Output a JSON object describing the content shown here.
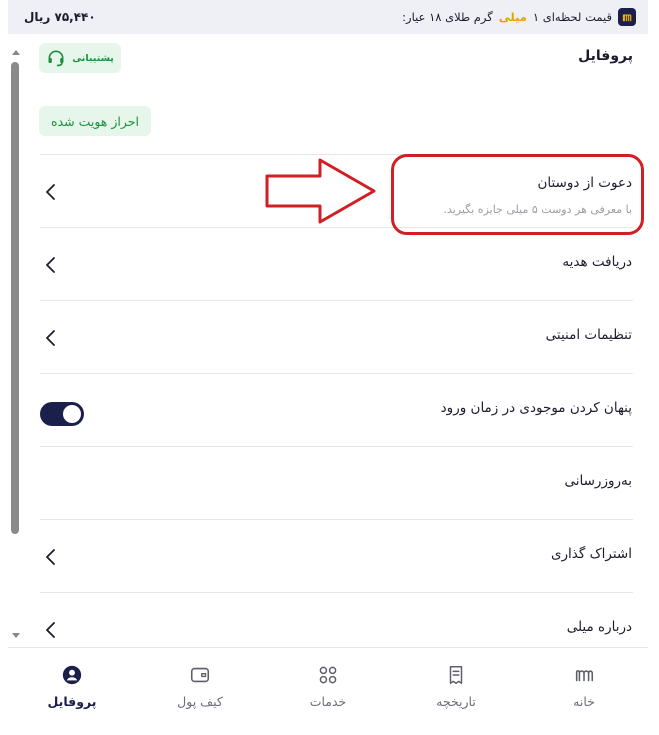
{
  "topbar": {
    "price_prefix": "قیمت لحظه‌ای ۱",
    "price_brand": "میلی",
    "price_suffix": "گرم طلای ۱۸ عیار:",
    "price_value": "۷۵,۴۴۰ ریال",
    "logo_icon": "mili-logo-icon"
  },
  "header": {
    "title": "پروفایل",
    "support_label": "پشتیبانی",
    "verified_label": "احراز هویت شده"
  },
  "rows": [
    {
      "label": "دعوت از دوستان",
      "sub": "با معرفی هر دوست ۵ میلی جایزه بگیرید."
    },
    {
      "label": "دریافت هدیه"
    },
    {
      "label": "تنظیمات امنیتی"
    },
    {
      "label": "پنهان کردن موجودی در زمان ورود",
      "toggle_on": true
    },
    {
      "label": "به‌روزرسانی"
    },
    {
      "label": "اشتراک گذاری"
    },
    {
      "label": "درباره میلی"
    }
  ],
  "bottom_nav": [
    {
      "label": "خانه",
      "icon": "home-logo-icon"
    },
    {
      "label": "تاریخچه",
      "icon": "receipt-icon"
    },
    {
      "label": "خدمات",
      "icon": "grid-icon"
    },
    {
      "label": "کیف پول",
      "icon": "wallet-icon"
    },
    {
      "label": "پروفایل",
      "icon": "user-icon",
      "active": true
    }
  ],
  "colors": {
    "brand_navy": "#1b1f4b",
    "success_green": "#1f8f3f",
    "success_bg": "#e6f6ea",
    "annotation_red": "#d11f24",
    "gold": "#e2a400"
  }
}
